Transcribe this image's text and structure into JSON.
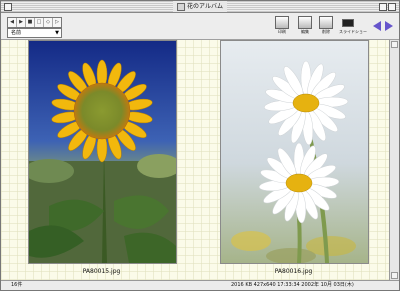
{
  "window": {
    "title": "花のアルバム"
  },
  "toolbar": {
    "buttons": [
      "◀",
      "▶",
      "■",
      "□",
      "◇",
      "▷"
    ],
    "sort_popup": "名前",
    "tools": [
      {
        "label": "印刷",
        "icon": "printer-icon"
      },
      {
        "label": "編集",
        "icon": "edit-icon"
      },
      {
        "label": "削除",
        "icon": "trash-icon"
      },
      {
        "label": "スライドショー",
        "icon": "slideshow-icon"
      }
    ]
  },
  "photos": [
    {
      "caption": "PA80015.jpg",
      "subject": "sunflower"
    },
    {
      "caption": "PA80016.jpg",
      "subject": "daisies"
    }
  ],
  "status": {
    "count": "16件",
    "info": "2016 KB  427x640  17:33:34  2002年 10月 03日(木)"
  },
  "colors": {
    "nav_arrow": "#6655cc",
    "background": "#fbfbe9"
  }
}
